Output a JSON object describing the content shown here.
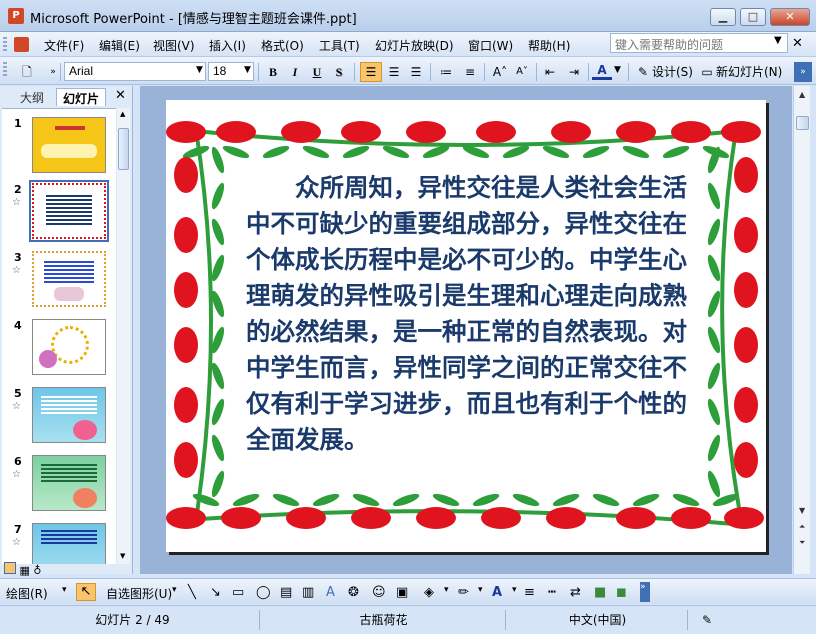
{
  "window": {
    "app_icon_label": "P",
    "title": "Microsoft PowerPoint - [情感与理智主题班会课件.ppt]",
    "minimize": "▁",
    "maximize": "□",
    "close": "✕"
  },
  "menu": {
    "items": [
      "文件(F)",
      "编辑(E)",
      "视图(V)",
      "插入(I)",
      "格式(O)",
      "工具(T)",
      "幻灯片放映(D)",
      "窗口(W)",
      "帮助(H)"
    ],
    "help_placeholder": "键入需要帮助的问题",
    "doc_close": "✕"
  },
  "toolbar": {
    "font_name": "Arial",
    "font_size": "18",
    "bold": "B",
    "italic": "I",
    "underline": "U",
    "shadow": "S",
    "design_label": "设计(S)",
    "new_slide_label": "新幻灯片(N)"
  },
  "left_panel": {
    "tab_outline": "大纲",
    "tab_slides": "幻灯片",
    "close": "✕",
    "thumbnails": [
      {
        "num": "1",
        "star": ""
      },
      {
        "num": "2",
        "star": "☆"
      },
      {
        "num": "3",
        "star": "☆"
      },
      {
        "num": "4",
        "star": ""
      },
      {
        "num": "5",
        "star": "☆"
      },
      {
        "num": "6",
        "star": "☆"
      },
      {
        "num": "7",
        "star": "☆"
      }
    ],
    "selected_index": 2
  },
  "slide": {
    "body": "众所周知，异性交往是人类社会生活中不可缺少的重要组成部分，异性交往在个体成长历程中是必不可少的。中学生心理萌发的异性吸引是生理和心理走向成熟的必然结果，是一种正常的自然表现。对中学生而言，异性同学之间的正常交往不仅有利于学习进步，而且也有利于个性的全面发展。",
    "text_color": "#1a3a6b",
    "flower_color": "#e0141e",
    "leaf_color": "#2e9e3a"
  },
  "drawing_toolbar": {
    "draw_label": "绘图(R)",
    "autoshapes_label": "自选图形(U)"
  },
  "status": {
    "slide_pos": "幻灯片 2 / 49",
    "design": "古瓶荷花",
    "language": "中文(中国)"
  }
}
